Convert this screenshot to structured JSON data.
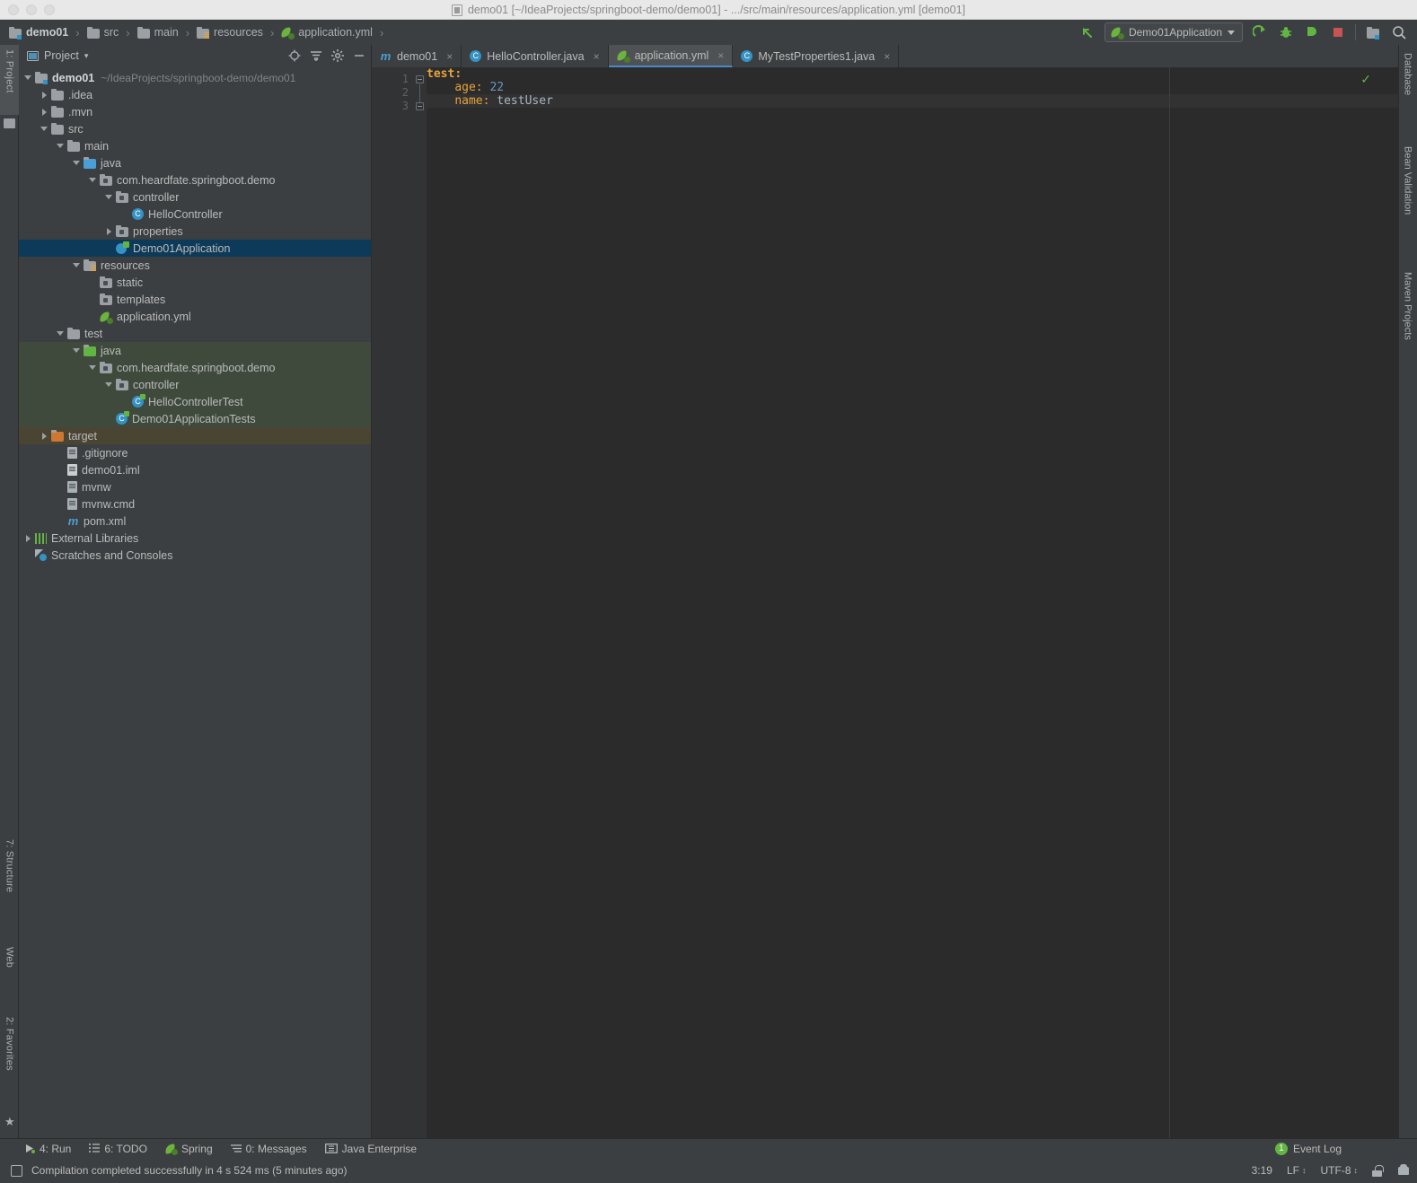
{
  "window": {
    "title": "demo01 [~/IdeaProjects/springboot-demo/demo01] - .../src/main/resources/application.yml [demo01]",
    "title_icon": "project-file-icon"
  },
  "breadcrumb": {
    "items": [
      {
        "label": "demo01",
        "icon": "module-folder-icon",
        "bold": true
      },
      {
        "label": "src",
        "icon": "folder-icon",
        "bold": false
      },
      {
        "label": "main",
        "icon": "folder-icon",
        "bold": false
      },
      {
        "label": "resources",
        "icon": "resources-folder-icon",
        "bold": false
      },
      {
        "label": "application.yml",
        "icon": "spring-yaml-icon",
        "bold": false
      }
    ],
    "separator": "›"
  },
  "toolbar": {
    "back_arrow": "back-arrow-icon",
    "run_config": "Demo01Application",
    "run_config_icon": "spring-boot-icon",
    "buttons": [
      {
        "name": "run-button",
        "icon": "run-icon"
      },
      {
        "name": "debug-button",
        "icon": "bug-icon"
      },
      {
        "name": "run-with-coverage-button",
        "icon": "coverage-icon"
      },
      {
        "name": "stop-button",
        "icon": "stop-icon"
      },
      {
        "name": "project-structure-button",
        "icon": "project-structure-icon"
      },
      {
        "name": "search-everywhere-button",
        "icon": "search-icon"
      }
    ]
  },
  "left_strip": {
    "tabs": [
      {
        "label": "1: Project",
        "active": true,
        "icon": "project-icon"
      },
      {
        "label": "7: Structure",
        "active": false,
        "icon": "structure-icon"
      },
      {
        "label": "Web",
        "active": false,
        "icon": "web-icon"
      },
      {
        "label": "2: Favorites",
        "active": false,
        "icon": "star-icon"
      }
    ]
  },
  "right_strip": {
    "tabs": [
      {
        "label": "Database",
        "icon": "database-icon"
      },
      {
        "label": "Bean Validation",
        "icon": "bean-validation-icon"
      },
      {
        "label": "Maven Projects",
        "icon": "maven-icon"
      }
    ]
  },
  "project_panel": {
    "title": "Project",
    "dropdown": "▾",
    "actions": [
      {
        "name": "locate-file-button",
        "icon": "target-icon"
      },
      {
        "name": "collapse-all-button",
        "icon": "collapse-all-icon"
      },
      {
        "name": "settings-button",
        "icon": "gear-icon"
      },
      {
        "name": "hide-button",
        "icon": "minimize-icon"
      }
    ],
    "tree": [
      {
        "id": "demo01",
        "label": "demo01",
        "suffix": "~/IdeaProjects/springboot-demo/demo01",
        "indent": 0,
        "arrow": "down",
        "icon": "module-folder-icon",
        "bold": true,
        "state": "none"
      },
      {
        "id": "idea",
        "label": ".idea",
        "suffix": "",
        "indent": 1,
        "arrow": "right",
        "icon": "folder-icon",
        "bold": false,
        "state": "none"
      },
      {
        "id": "mvn",
        "label": ".mvn",
        "suffix": "",
        "indent": 1,
        "arrow": "right",
        "icon": "folder-icon",
        "bold": false,
        "state": "none"
      },
      {
        "id": "src",
        "label": "src",
        "suffix": "",
        "indent": 1,
        "arrow": "down",
        "icon": "folder-icon",
        "bold": false,
        "state": "none"
      },
      {
        "id": "main",
        "label": "main",
        "suffix": "",
        "indent": 2,
        "arrow": "down",
        "icon": "folder-icon",
        "bold": false,
        "state": "none"
      },
      {
        "id": "main-java",
        "label": "java",
        "suffix": "",
        "indent": 3,
        "arrow": "down",
        "icon": "source-folder-icon",
        "bold": false,
        "state": "none"
      },
      {
        "id": "main-pkg",
        "label": "com.heardfate.springboot.demo",
        "suffix": "",
        "indent": 4,
        "arrow": "down",
        "icon": "package-icon",
        "bold": false,
        "state": "none"
      },
      {
        "id": "main-controller",
        "label": "controller",
        "suffix": "",
        "indent": 5,
        "arrow": "down",
        "icon": "package-icon",
        "bold": false,
        "state": "none"
      },
      {
        "id": "hello-controller",
        "label": "HelloController",
        "suffix": "",
        "indent": 6,
        "arrow": "none",
        "icon": "class-icon",
        "bold": false,
        "state": "none"
      },
      {
        "id": "properties",
        "label": "properties",
        "suffix": "",
        "indent": 5,
        "arrow": "right",
        "icon": "package-icon",
        "bold": false,
        "state": "none"
      },
      {
        "id": "demo01application",
        "label": "Demo01Application",
        "suffix": "",
        "indent": 5,
        "arrow": "none",
        "icon": "spring-boot-class-icon",
        "bold": false,
        "state": "selected"
      },
      {
        "id": "resources",
        "label": "resources",
        "suffix": "",
        "indent": 3,
        "arrow": "down",
        "icon": "resources-folder-icon",
        "bold": false,
        "state": "none"
      },
      {
        "id": "static",
        "label": "static",
        "suffix": "",
        "indent": 4,
        "arrow": "none",
        "icon": "package-icon",
        "bold": false,
        "state": "none"
      },
      {
        "id": "templates",
        "label": "templates",
        "suffix": "",
        "indent": 4,
        "arrow": "none",
        "icon": "package-icon",
        "bold": false,
        "state": "none"
      },
      {
        "id": "application-yml",
        "label": "application.yml",
        "suffix": "",
        "indent": 4,
        "arrow": "none",
        "icon": "spring-yaml-icon",
        "bold": false,
        "state": "none"
      },
      {
        "id": "test",
        "label": "test",
        "suffix": "",
        "indent": 2,
        "arrow": "down",
        "icon": "folder-icon",
        "bold": false,
        "state": "none"
      },
      {
        "id": "test-java",
        "label": "java",
        "suffix": "",
        "indent": 3,
        "arrow": "down",
        "icon": "test-source-folder-icon",
        "bold": false,
        "state": "test"
      },
      {
        "id": "test-pkg",
        "label": "com.heardfate.springboot.demo",
        "suffix": "",
        "indent": 4,
        "arrow": "down",
        "icon": "package-icon",
        "bold": false,
        "state": "test"
      },
      {
        "id": "test-controller",
        "label": "controller",
        "suffix": "",
        "indent": 5,
        "arrow": "down",
        "icon": "package-icon",
        "bold": false,
        "state": "test"
      },
      {
        "id": "hello-controller-test",
        "label": "HelloControllerTest",
        "suffix": "",
        "indent": 6,
        "arrow": "none",
        "icon": "test-class-icon",
        "bold": false,
        "state": "test"
      },
      {
        "id": "demo01applicationtests",
        "label": "Demo01ApplicationTests",
        "suffix": "",
        "indent": 5,
        "arrow": "none",
        "icon": "test-class-icon",
        "bold": false,
        "state": "test"
      },
      {
        "id": "target",
        "label": "target",
        "suffix": "",
        "indent": 1,
        "arrow": "right",
        "icon": "excluded-folder-icon",
        "bold": false,
        "state": "target"
      },
      {
        "id": "gitignore",
        "label": ".gitignore",
        "suffix": "",
        "indent": 2,
        "arrow": "none",
        "icon": "file-icon",
        "bold": false,
        "state": "none"
      },
      {
        "id": "demo01-iml",
        "label": "demo01.iml",
        "suffix": "",
        "indent": 2,
        "arrow": "none",
        "icon": "module-file-icon",
        "bold": false,
        "state": "none"
      },
      {
        "id": "mvnw",
        "label": "mvnw",
        "suffix": "",
        "indent": 2,
        "arrow": "none",
        "icon": "file-icon",
        "bold": false,
        "state": "none"
      },
      {
        "id": "mvnw-cmd",
        "label": "mvnw.cmd",
        "suffix": "",
        "indent": 2,
        "arrow": "none",
        "icon": "file-icon",
        "bold": false,
        "state": "none"
      },
      {
        "id": "pom-xml",
        "label": "pom.xml",
        "suffix": "",
        "indent": 2,
        "arrow": "none",
        "icon": "maven-file-icon",
        "bold": false,
        "state": "none"
      },
      {
        "id": "external-libraries",
        "label": "External Libraries",
        "suffix": "",
        "indent": 0,
        "arrow": "right",
        "icon": "libraries-icon",
        "bold": false,
        "state": "none"
      },
      {
        "id": "scratches",
        "label": "Scratches and Consoles",
        "suffix": "",
        "indent": 0,
        "arrow": "none",
        "icon": "scratches-icon",
        "bold": false,
        "state": "none"
      }
    ]
  },
  "editor": {
    "tabs": [
      {
        "label": "demo01",
        "icon": "maven-file-icon",
        "active": false,
        "close": "×"
      },
      {
        "label": "HelloController.java",
        "icon": "class-icon",
        "active": false,
        "close": "×"
      },
      {
        "label": "application.yml",
        "icon": "spring-yaml-icon",
        "active": true,
        "close": "×"
      },
      {
        "label": "MyTestProperties1.java",
        "icon": "class-icon",
        "active": false,
        "close": "×"
      }
    ],
    "lines": [
      {
        "num": "1",
        "indent": 0,
        "key": "test",
        "colon": ":",
        "value": "",
        "value_type": "none",
        "fold": "open"
      },
      {
        "num": "2",
        "indent": 4,
        "key": "age",
        "colon": ":",
        "value": "22",
        "value_type": "number",
        "fold": "none"
      },
      {
        "num": "3",
        "indent": 4,
        "key": "name",
        "colon": ":",
        "value": "testUser",
        "value_type": "string",
        "fold": "close"
      }
    ],
    "inspection_status": "ok-check-icon"
  },
  "bottom_bar": {
    "items": [
      {
        "label": "4: Run",
        "underline": "4",
        "icon": "run-icon"
      },
      {
        "label": "6: TODO",
        "underline": "6",
        "icon": "todo-icon"
      },
      {
        "label": "Spring",
        "underline": "",
        "icon": "spring-icon"
      },
      {
        "label": "0: Messages",
        "underline": "0",
        "icon": "messages-icon"
      },
      {
        "label": "Java Enterprise",
        "underline": "",
        "icon": "java-enterprise-icon"
      }
    ],
    "event_log": {
      "label": "Event Log",
      "count": "1"
    }
  },
  "status_bar": {
    "message": "Compilation completed successfully in 4 s 524 ms (5 minutes ago)",
    "caret_position": "3:19",
    "line_separator": "LF",
    "encoding": "UTF-8",
    "lock_icon": "unlocked-icon",
    "inspection_icon": "hector-icon"
  }
}
